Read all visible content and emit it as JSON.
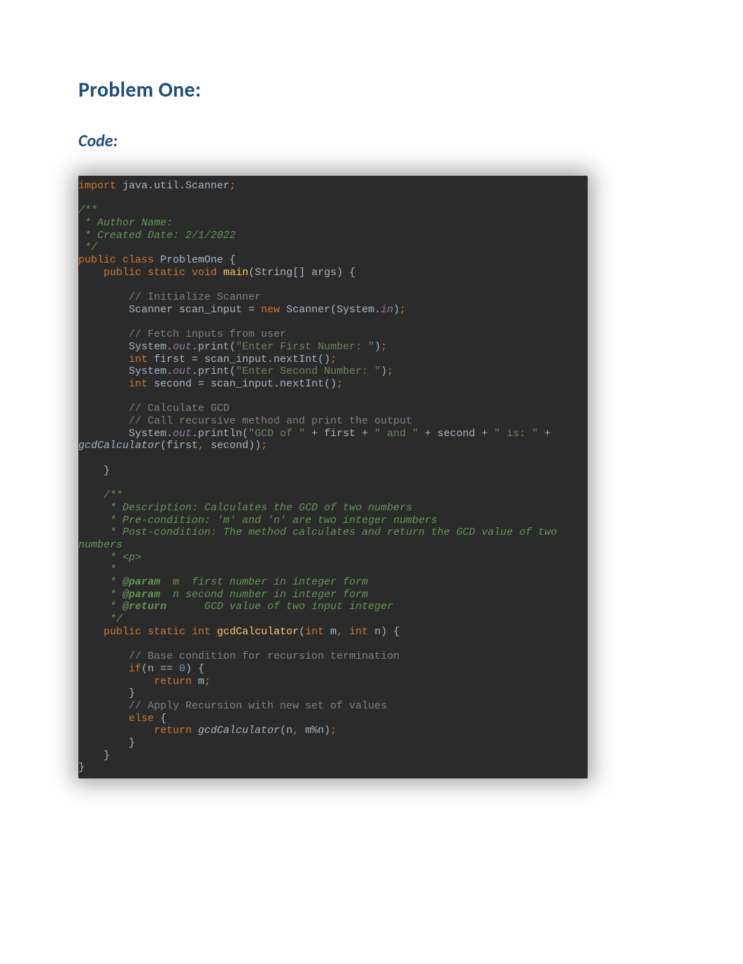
{
  "headings": {
    "problem": "Problem One:",
    "code": "Code:"
  },
  "code": {
    "l1_import": "import",
    "l1_pkg": " java.util.Scanner",
    "l1_sc": ";",
    "doc1_a": "/**",
    "doc1_b": " * Author Name:",
    "doc1_c": " * Created Date: 2/1/2022",
    "doc1_d": " */",
    "cls_public": "public ",
    "cls_class": "class ",
    "cls_name": "ProblemOne {",
    "main_public": "    public ",
    "main_static": "static ",
    "main_void": "void ",
    "main_name": "main",
    "main_sig": "(String[] args) {",
    "blank": "",
    "cmt_init": "        // Initialize Scanner",
    "scan_indent": "        Scanner scan_input = ",
    "scan_new": "new ",
    "scan_ctor": "Scanner(System.",
    "scan_in": "in",
    "scan_close": ")",
    "scan_sc": ";",
    "cmt_fetch": "        // Fetch inputs from user",
    "p1_sys": "        System.",
    "p1_out": "out",
    "p1_call": ".print(",
    "p1_str": "\"Enter First Number: \"",
    "p1_close": ")",
    "p1_sc": ";",
    "first_indent": "        ",
    "first_int": "int ",
    "first_rest": "first = scan_input.nextInt()",
    "first_sc": ";",
    "p2_sys": "        System.",
    "p2_out": "out",
    "p2_call": ".print(",
    "p2_str": "\"Enter Second Number: \"",
    "p2_close": ")",
    "p2_sc": ";",
    "second_indent": "        ",
    "second_int": "int ",
    "second_rest": "second = scan_input.nextInt()",
    "second_sc": ";",
    "cmt_gcd": "        // Calculate GCD",
    "cmt_callrec": "        // Call recursive method and print the output",
    "out_sys": "        System.",
    "out_out": "out",
    "out_call": ".println(",
    "out_s1": "\"GCD of \"",
    "out_p1": " + first + ",
    "out_s2": "\" and \"",
    "out_p2": " + second + ",
    "out_s3": "\" is: \"",
    "out_p3": " + ",
    "out2_call": "gcdCalculator",
    "out2_a": "(first",
    "out2_comma": ",",
    "out2_b": " second))",
    "out2_sc": ";",
    "close_main": "    }",
    "d2_a": "    /**",
    "d2_b": "     * Description: Calculates the GCD of two numbers",
    "d2_c": "     * Pre-condition: 'm' and 'n' are two integer numbers",
    "d2_d": "     * Post-condition: The method calculates and return the GCD value of two ",
    "d2_d2": "numbers",
    "d2_e": "     * <p>",
    "d2_f": "     *",
    "d2_g_pre": "     * ",
    "d2_g_tag": "@param ",
    "d2_g_rest": " m  first number in integer form",
    "d2_h_pre": "     * ",
    "d2_h_tag": "@param ",
    "d2_h_rest": " n second number in integer form",
    "d2_i_pre": "     * ",
    "d2_i_tag": "@return",
    "d2_i_rest": "      GCD value of two input integer",
    "d2_j": "     */",
    "gcd_indent": "    ",
    "gcd_public": "public ",
    "gcd_static": "static ",
    "gcd_int": "int ",
    "gcd_name": "gcdCalculator",
    "gcd_open": "(",
    "gcd_int1": "int ",
    "gcd_m": "m",
    "gcd_comma": ",",
    "gcd_sp": " ",
    "gcd_int2": "int ",
    "gcd_n": "n) {",
    "cmt_base": "        // Base condition for recursion termination",
    "if_indent": "        ",
    "if_kw": "if",
    "if_open": "(n == ",
    "if_zero": "0",
    "if_close": ") {",
    "ret1_indent": "            ",
    "ret1_kw": "return ",
    "ret1_val": "m",
    "ret1_sc": ";",
    "close_if": "        }",
    "cmt_apply": "        // Apply Recursion with new set of values",
    "else_indent": "        ",
    "else_kw": "else ",
    "else_brace": "{",
    "ret2_indent": "            ",
    "ret2_kw": "return ",
    "ret2_call": "gcdCalculator",
    "ret2_a": "(n",
    "ret2_comma": ",",
    "ret2_b": " m%n)",
    "ret2_sc": ";",
    "close_else": "        }",
    "close_gcd": "    }",
    "close_cls": "}"
  }
}
